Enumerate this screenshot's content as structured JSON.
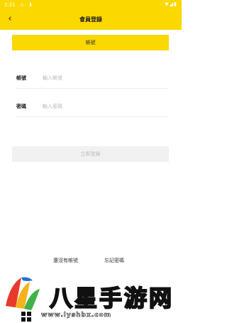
{
  "status_bar": {
    "time": "2:21",
    "left_icons": "⚠ ⬇",
    "right_icons": "▼◢▮"
  },
  "nav": {
    "back_icon": "back-arrow-icon",
    "back_glyph": "‹",
    "title": "會員登錄"
  },
  "tab": {
    "label": "帳號"
  },
  "form": {
    "account_label": "帳號",
    "account_placeholder": "輸入帳號",
    "password_label": "密碼",
    "password_placeholder": "輸入密碼",
    "submit_label": "立即登錄"
  },
  "footer_links": {
    "register": "還沒有帳號",
    "forgot": "忘記密碼"
  },
  "watermark": {
    "brand": "八星手游网",
    "url": "www.lyshbx.com"
  },
  "colors": {
    "accent": "#fad800",
    "button_disabled_bg": "#f1f1f1"
  }
}
